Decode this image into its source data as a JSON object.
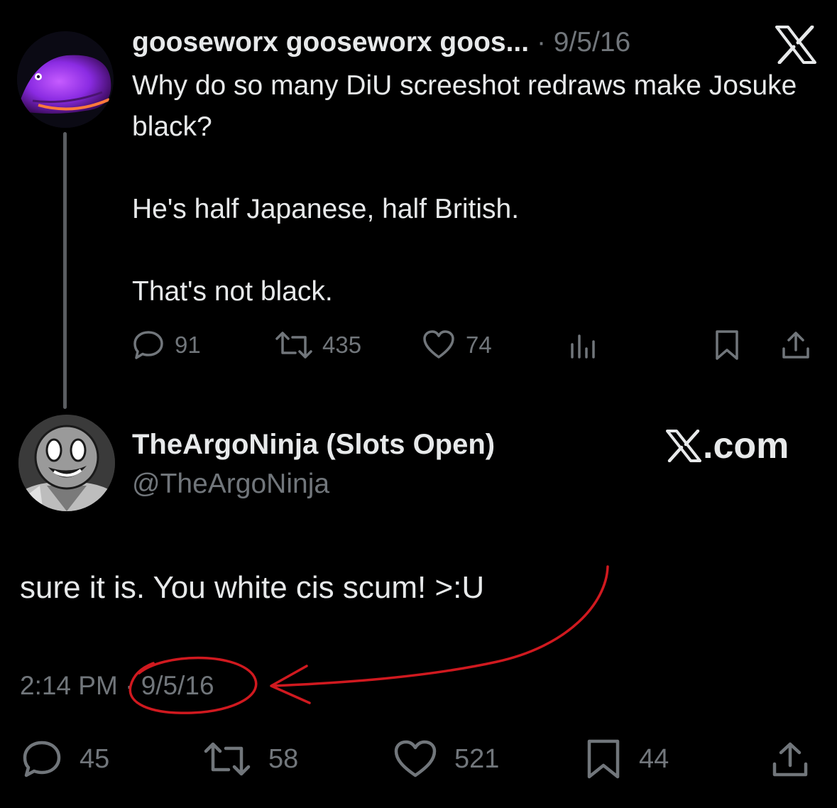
{
  "parent_tweet": {
    "display_name": "gooseworx gooseworx goos...",
    "separator": "·",
    "date": "9/5/16",
    "text_lines": [
      "Why do so many DiU screeshot redraws make Josuke black?",
      "",
      "He's half Japanese, half British.",
      "",
      "That's not black."
    ],
    "actions": {
      "replies": "91",
      "reposts": "435",
      "likes": "74"
    },
    "platform_icon": "x-logo-icon"
  },
  "reply_tweet": {
    "display_name": "TheArgoNinja (Slots Open)",
    "handle": "@TheArgoNinja",
    "brand_label": ".com",
    "text": "sure it is. You white cis scum! >:U",
    "time": "2:14 PM",
    "separator": "·",
    "date": "9/5/16",
    "actions": {
      "replies": "45",
      "reposts": "58",
      "likes": "521",
      "bookmarks": "44"
    }
  },
  "colors": {
    "background": "#000000",
    "primary_text": "#e7e9ea",
    "secondary_text": "#71767b",
    "annotation_red": "#d0191f",
    "thread_line": "#5a5d61"
  }
}
